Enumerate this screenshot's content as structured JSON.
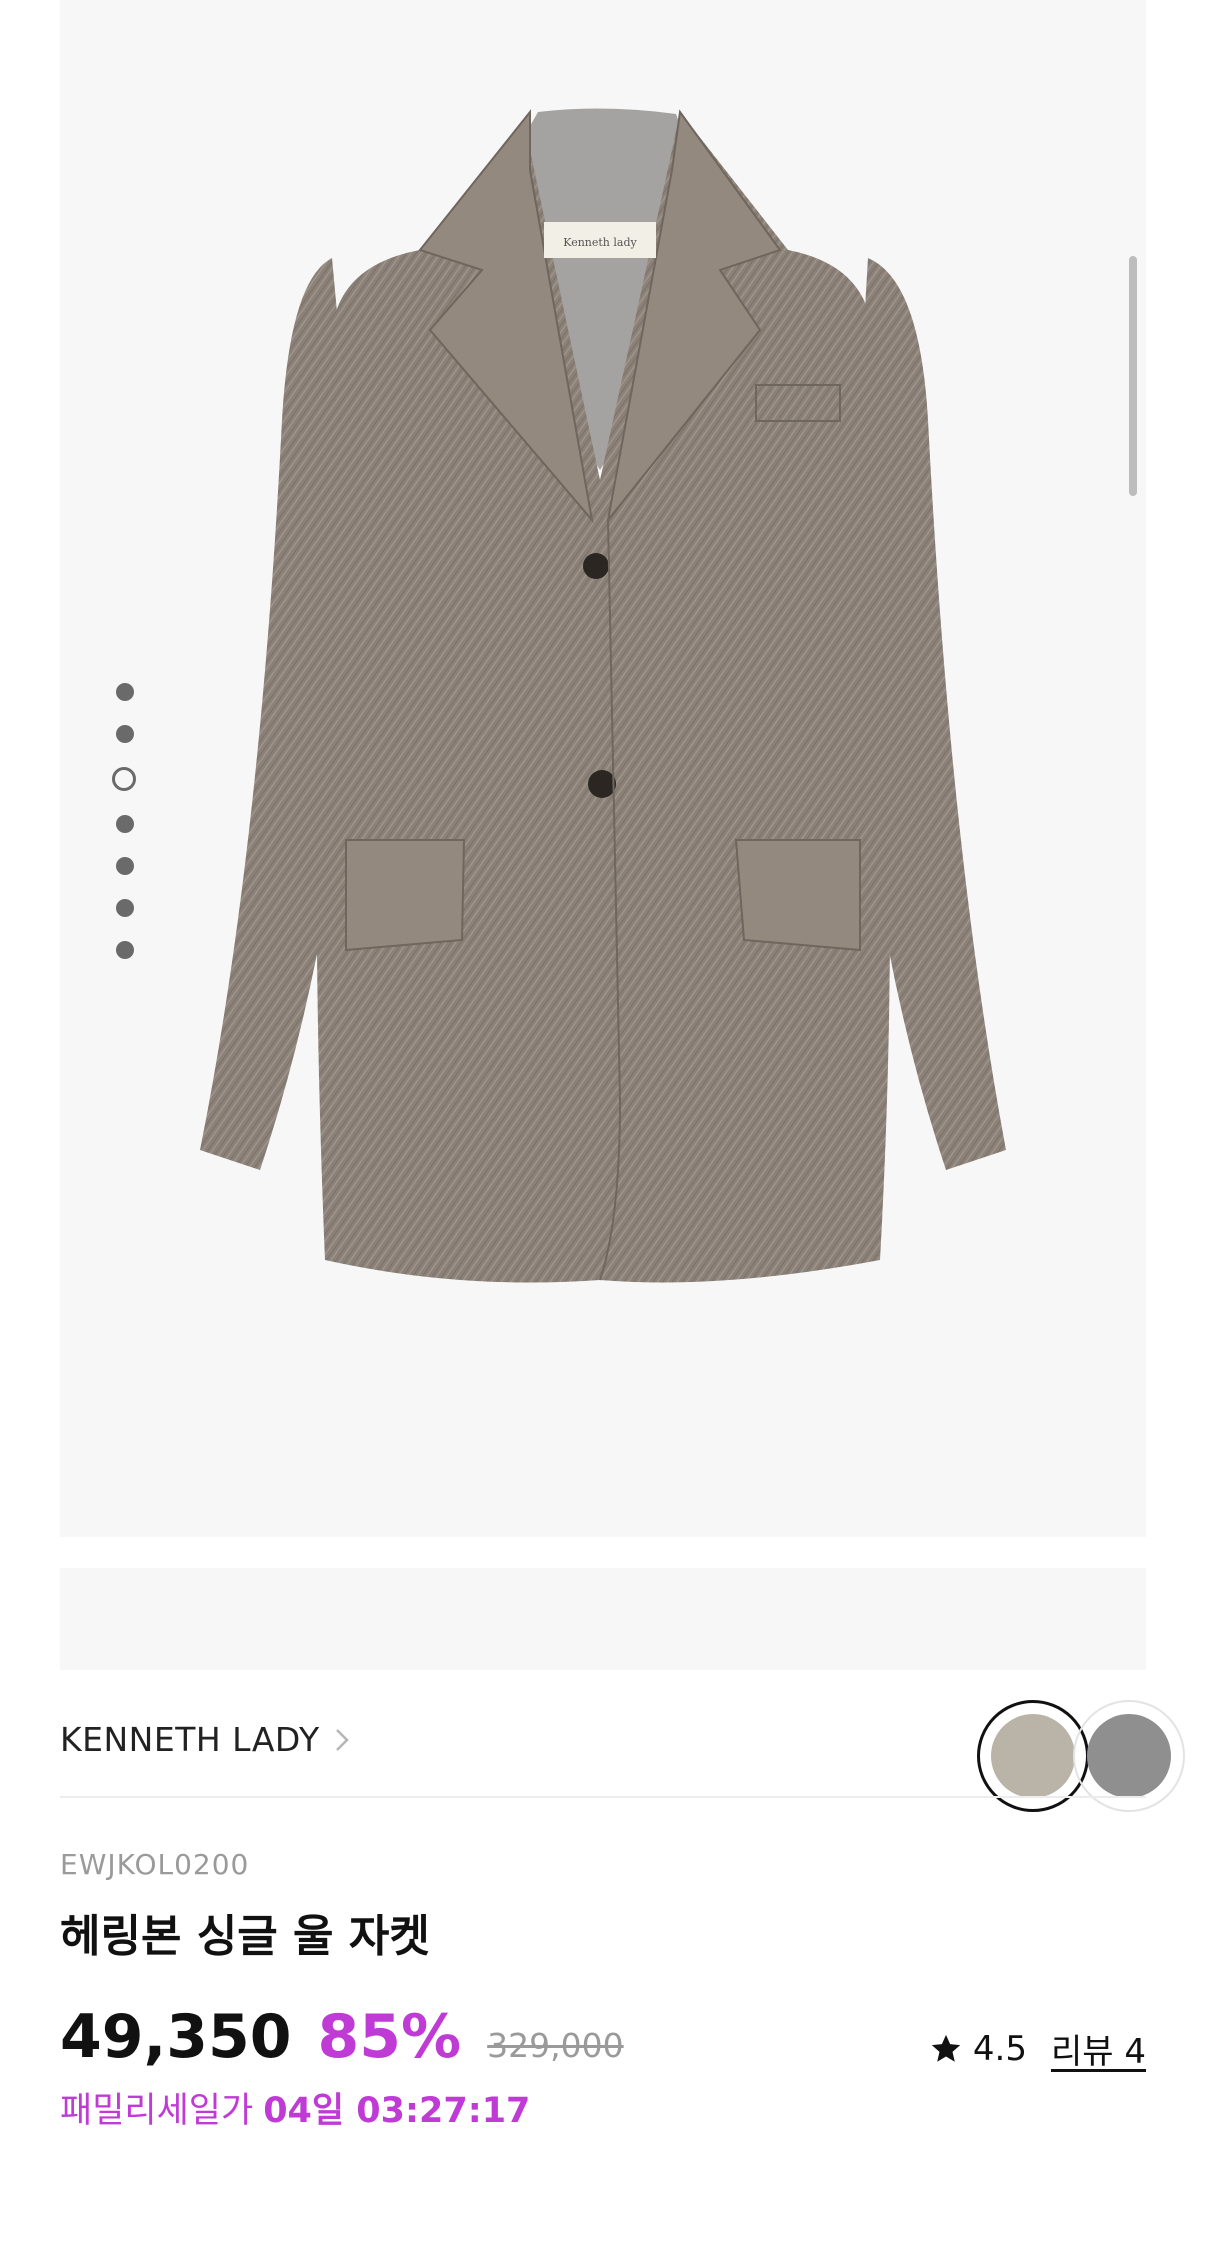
{
  "product_image": {
    "alt": "herringbone wool jacket",
    "brand_tag": "Kenneth lady"
  },
  "gallery": {
    "total": 7,
    "active_index": 2
  },
  "brand": {
    "name": "KENNETH LADY"
  },
  "colors": {
    "selected": "#b9b4a7",
    "other": "#8f8f8f",
    "accent": "#c03ad6"
  },
  "product": {
    "sku": "EWJKOL0200",
    "title": "헤링본 싱글 울 자켓",
    "price": "49,350",
    "discount": "85%",
    "original_price": "329,000",
    "rating": "4.5",
    "review_label": "리뷰 4",
    "sale_label": "패밀리세일가",
    "sale_countdown": "04일 03:27:17"
  }
}
